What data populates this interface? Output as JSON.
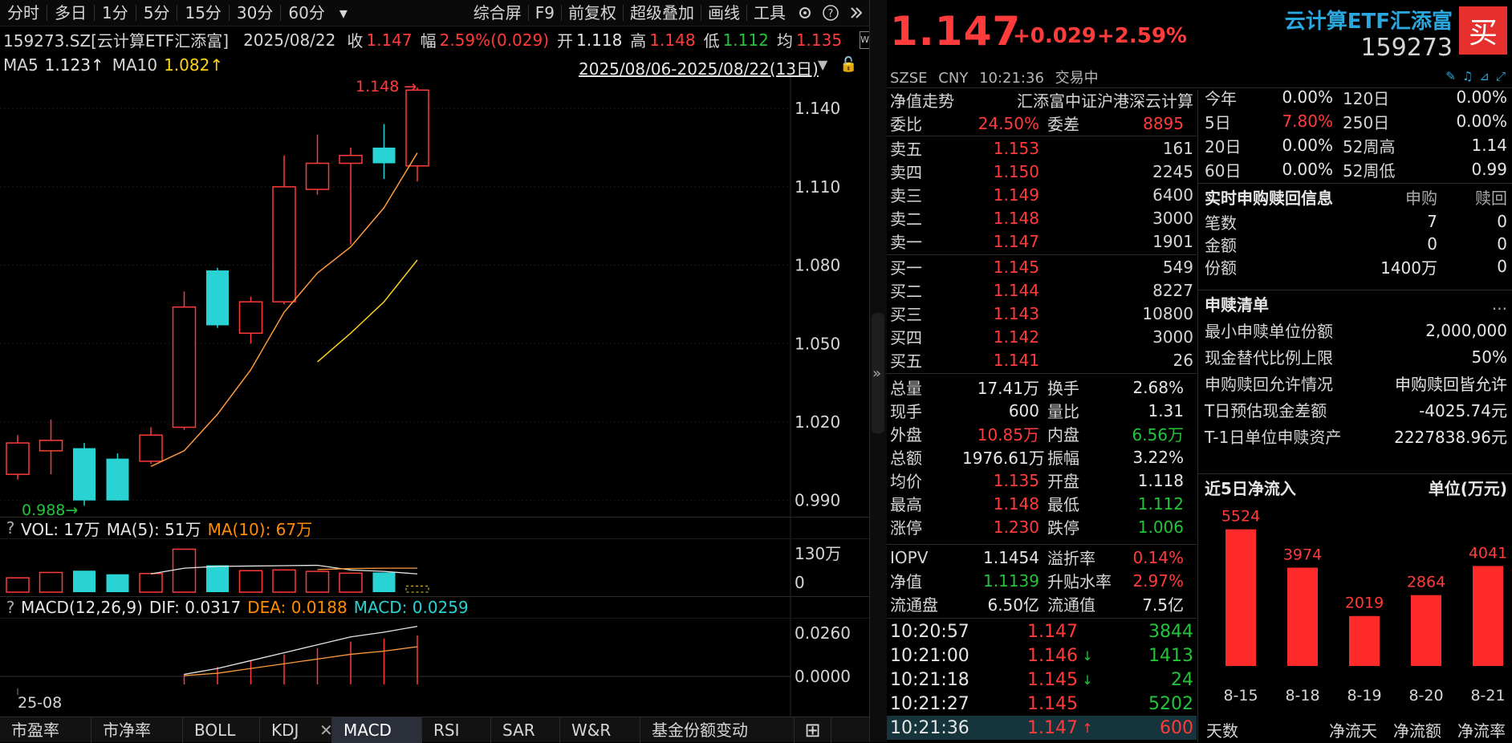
{
  "toolbar": {
    "periods": [
      "分时",
      "多日",
      "1分",
      "5分",
      "15分",
      "30分",
      "60分"
    ],
    "more": "▾",
    "tools": [
      "综合屏",
      "F9",
      "前复权",
      "超级叠加",
      "画线",
      "工具"
    ]
  },
  "info": {
    "code": "159273.SZ[云计算ETF汇添富]",
    "date": "2025/08/22",
    "close_label": "收",
    "close": "1.147",
    "amp_label": "幅",
    "amp": "2.59%(0.029)",
    "open_label": "开",
    "open": "1.118",
    "high_label": "高",
    "high": "1.148",
    "low_label": "低",
    "low": "1.112",
    "avg_label": "均",
    "avg": "1.135"
  },
  "ma": {
    "ma5_label": "MA5",
    "ma5": "1.123↑",
    "ma10_label": "MA10",
    "ma10": "1.082↑",
    "range": "2025/08/06-2025/08/22(13日)"
  },
  "price_axis": [
    "1.140",
    "1.110",
    "1.080",
    "1.050",
    "1.020",
    "0.990"
  ],
  "hi_mark": "1.148",
  "lo_mark": "0.988",
  "vol": {
    "label": "VOL: 17万",
    "ma5": "MA(5): 51万",
    "ma10": "MA(10): 67万",
    "axis_top": "130万",
    "axis_bot": "0"
  },
  "macd": {
    "label": "MACD(12,26,9)",
    "dif": "DIF: 0.0317",
    "dea": "DEA: 0.0188",
    "macd": "MACD: 0.0259",
    "axis_top": "0.0260",
    "axis_bot": "0.0000",
    "date_label": "25-08"
  },
  "bottom_tabs": [
    "市盈率",
    "市净率",
    "BOLL",
    "KDJ",
    "MACD",
    "RSI",
    "SAR",
    "W&R",
    "基金份额变动"
  ],
  "chart_data": {
    "type": "candlestick",
    "candles": [
      {
        "o": 1.0,
        "c": 1.012,
        "h": 1.015,
        "l": 0.998
      },
      {
        "o": 1.009,
        "c": 1.013,
        "h": 1.021,
        "l": 1.0
      },
      {
        "o": 1.01,
        "c": 0.99,
        "h": 1.012,
        "l": 0.988
      },
      {
        "o": 1.006,
        "c": 0.99,
        "h": 1.008,
        "l": 0.99
      },
      {
        "o": 1.005,
        "c": 1.015,
        "h": 1.018,
        "l": 1.004
      },
      {
        "o": 1.018,
        "c": 1.064,
        "h": 1.07,
        "l": 1.017
      },
      {
        "o": 1.078,
        "c": 1.057,
        "h": 1.079,
        "l": 1.056
      },
      {
        "o": 1.054,
        "c": 1.066,
        "h": 1.068,
        "l": 1.05
      },
      {
        "o": 1.066,
        "c": 1.11,
        "h": 1.122,
        "l": 1.065
      },
      {
        "o": 1.109,
        "c": 1.119,
        "h": 1.13,
        "l": 1.107
      },
      {
        "o": 1.119,
        "c": 1.122,
        "h": 1.125,
        "l": 1.088
      },
      {
        "o": 1.125,
        "c": 1.119,
        "h": 1.134,
        "l": 1.113
      },
      {
        "o": 1.118,
        "c": 1.147,
        "h": 1.148,
        "l": 1.112
      }
    ],
    "ma5": [
      null,
      null,
      null,
      null,
      1.003,
      1.009,
      1.023,
      1.04,
      1.062,
      1.077,
      1.087,
      1.102,
      1.123
    ],
    "ma10": [
      null,
      null,
      null,
      null,
      null,
      null,
      null,
      null,
      null,
      1.043,
      1.054,
      1.066,
      1.082
    ],
    "volumes": [
      40,
      55,
      60,
      50,
      52,
      120,
      75,
      60,
      62,
      58,
      53,
      55,
      17
    ],
    "vol_ma5": [
      null,
      null,
      null,
      null,
      51,
      67,
      72,
      73,
      74,
      75,
      62,
      58,
      51
    ],
    "vol_ma10": [
      null,
      null,
      null,
      null,
      null,
      null,
      null,
      null,
      null,
      63,
      66,
      67,
      67
    ],
    "dif": [
      null,
      null,
      null,
      null,
      null,
      0.0013,
      0.005,
      0.01,
      0.015,
      0.02,
      0.025,
      0.028,
      0.0317
    ],
    "dea": [
      null,
      null,
      null,
      null,
      null,
      0.0005,
      0.002,
      0.005,
      0.008,
      0.011,
      0.014,
      0.016,
      0.0188
    ],
    "macd_hist": [
      0,
      0,
      0,
      0,
      0,
      0.0016,
      0.006,
      0.01,
      0.014,
      0.018,
      0.022,
      0.024,
      0.0259
    ],
    "ylim": [
      0.985,
      1.152
    ]
  },
  "quote": {
    "price": "1.147",
    "change": "+0.029",
    "pct": "+2.59%",
    "name": "云计算ETF汇添富",
    "code": "159273",
    "buy": "买",
    "exchange": "SZSE",
    "currency": "CNY",
    "time": "10:21:36",
    "status": "交易中",
    "nav_trend": "净值走势",
    "fund_full": "汇添富中证沪港深云计算",
    "weibi_label": "委比",
    "weibi": "24.50%",
    "weicha_label": "委差",
    "weicha": "8895",
    "sells": [
      [
        "卖五",
        "1.153",
        "161"
      ],
      [
        "卖四",
        "1.150",
        "2245"
      ],
      [
        "卖三",
        "1.149",
        "6400"
      ],
      [
        "卖二",
        "1.148",
        "3000"
      ],
      [
        "卖一",
        "1.147",
        "1901"
      ]
    ],
    "buys": [
      [
        "买一",
        "1.145",
        "549"
      ],
      [
        "买二",
        "1.144",
        "8227"
      ],
      [
        "买三",
        "1.143",
        "10800"
      ],
      [
        "买四",
        "1.142",
        "3000"
      ],
      [
        "买五",
        "1.141",
        "26"
      ]
    ],
    "stats": [
      [
        "总量",
        "17.41万",
        "换手",
        "2.68%"
      ],
      [
        "现手",
        "600",
        "量比",
        "1.31"
      ],
      [
        "外盘",
        "10.85万",
        "内盘",
        "6.56万"
      ],
      [
        "总额",
        "1976.61万",
        "振幅",
        "3.22%"
      ],
      [
        "均价",
        "1.135",
        "开盘",
        "1.118"
      ],
      [
        "最高",
        "1.148",
        "最低",
        "1.112"
      ],
      [
        "涨停",
        "1.230",
        "跌停",
        "1.006"
      ]
    ],
    "stats2": [
      [
        "IOPV",
        "1.1454",
        "溢折率",
        "0.14%"
      ],
      [
        "净值",
        "1.1139",
        "升贴水率",
        "2.97%"
      ],
      [
        "流通盘",
        "6.50亿",
        "流通值",
        "7.5亿"
      ]
    ],
    "ticks": [
      [
        "10:20:57",
        "1.147",
        "",
        "3844"
      ],
      [
        "10:21:00",
        "1.146",
        "↓",
        "1413"
      ],
      [
        "10:21:18",
        "1.145",
        "↓",
        "24"
      ],
      [
        "10:21:27",
        "1.145",
        "",
        "5202"
      ],
      [
        "10:21:36",
        "1.147",
        "↑",
        "600"
      ]
    ]
  },
  "perf": [
    [
      "今年",
      "0.00%",
      "120日",
      "0.00%"
    ],
    [
      "5日",
      "7.80%",
      "250日",
      "0.00%"
    ],
    [
      "20日",
      "0.00%",
      "52周高",
      "1.14"
    ],
    [
      "60日",
      "0.00%",
      "52周低",
      "0.99"
    ]
  ],
  "redeem": {
    "title": "实时申购赎回信息",
    "col1": "申购",
    "col2": "赎回",
    "rows": [
      [
        "笔数",
        "7",
        "0"
      ],
      [
        "金额",
        "0",
        "0"
      ],
      [
        "份额",
        "1400万",
        "0"
      ]
    ]
  },
  "list": {
    "title": "申赎清单",
    "more": "...",
    "rows": [
      [
        "最小申赎单位份额",
        "2,000,000"
      ],
      [
        "现金替代比例上限",
        "50%"
      ],
      [
        "申购赎回允许情况",
        "申购赎回皆允许"
      ],
      [
        "T日预估现金差额",
        "-4025.74元"
      ],
      [
        "T-1日单位申赎资产",
        "2227838.96元"
      ]
    ]
  },
  "inflow": {
    "title": "近5日净流入",
    "unit": "单位(万元)",
    "footer": [
      "天数",
      "净流天",
      "净流额",
      "净流率"
    ]
  },
  "inflow_chart": {
    "type": "bar",
    "categories": [
      "8-15",
      "8-18",
      "8-19",
      "8-20",
      "8-21"
    ],
    "values": [
      5524,
      3974,
      2019,
      2864,
      4041
    ]
  },
  "colors": {
    "up": "#ff3b3b",
    "down": "#29d3d3",
    "ma5": "#e6e6e6",
    "ma10": "#ffd21a",
    "accent": "#29a8e0"
  }
}
